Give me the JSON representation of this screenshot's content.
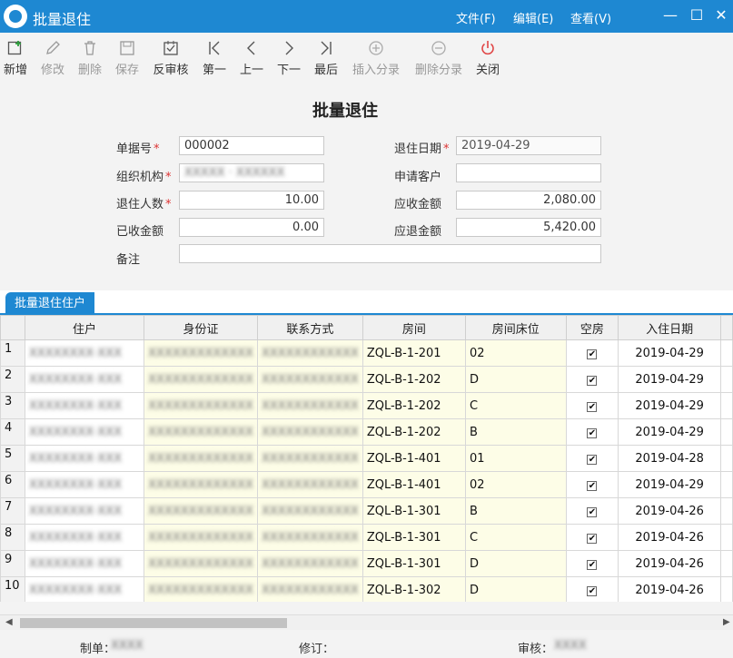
{
  "window": {
    "title": "批量退住",
    "menus": [
      "文件(F)",
      "编辑(E)",
      "查看(V)"
    ]
  },
  "toolbar": {
    "items": [
      {
        "label": "新增",
        "icon": "add-icon"
      },
      {
        "label": "修改",
        "icon": "edit-icon"
      },
      {
        "label": "删除",
        "icon": "trash-icon"
      },
      {
        "label": "保存",
        "icon": "save-icon"
      },
      {
        "label": "反审核",
        "icon": "unapprove-icon"
      },
      {
        "label": "第一",
        "icon": "first-icon"
      },
      {
        "label": "上一",
        "icon": "prev-icon"
      },
      {
        "label": "下一",
        "icon": "next-icon"
      },
      {
        "label": "最后",
        "icon": "last-icon"
      },
      {
        "label": "插入分录",
        "icon": "insert-row-icon"
      },
      {
        "label": "删除分录",
        "icon": "delete-row-icon"
      },
      {
        "label": "关闭",
        "icon": "power-icon"
      }
    ]
  },
  "form": {
    "title": "批量退住",
    "doc_no_label": "单据号",
    "doc_no": "000002",
    "checkout_date_label": "退住日期",
    "checkout_date": "2019-04-29",
    "org_label": "组织机构",
    "org": "XXXXX · XXXXXX",
    "customer_label": "申请客户",
    "customer": "",
    "count_label": "退住人数",
    "count": "10.00",
    "receivable_label": "应收金额",
    "receivable": "2,080.00",
    "received_label": "已收金额",
    "received": "0.00",
    "refund_label": "应退金额",
    "refund": "5,420.00",
    "remark_label": "备注",
    "remark": ""
  },
  "tab": {
    "label": "批量退住住户"
  },
  "grid": {
    "columns": [
      "住户",
      "身份证",
      "联系方式",
      "房间",
      "房间床位",
      "空房",
      "入住日期"
    ],
    "rows": [
      {
        "n": "1",
        "room": "ZQL-B-1-201",
        "bed": "02",
        "date": "2019-04-29"
      },
      {
        "n": "2",
        "room": "ZQL-B-1-202",
        "bed": "D",
        "date": "2019-04-29"
      },
      {
        "n": "3",
        "room": "ZQL-B-1-202",
        "bed": "C",
        "date": "2019-04-29"
      },
      {
        "n": "4",
        "room": "ZQL-B-1-202",
        "bed": "B",
        "date": "2019-04-29"
      },
      {
        "n": "5",
        "room": "ZQL-B-1-401",
        "bed": "01",
        "date": "2019-04-28"
      },
      {
        "n": "6",
        "room": "ZQL-B-1-401",
        "bed": "02",
        "date": "2019-04-29"
      },
      {
        "n": "7",
        "room": "ZQL-B-1-301",
        "bed": "B",
        "date": "2019-04-26"
      },
      {
        "n": "8",
        "room": "ZQL-B-1-301",
        "bed": "C",
        "date": "2019-04-26"
      },
      {
        "n": "9",
        "room": "ZQL-B-1-301",
        "bed": "D",
        "date": "2019-04-26"
      },
      {
        "n": "10",
        "room": "ZQL-B-1-302",
        "bed": "D",
        "date": "2019-04-26"
      }
    ]
  },
  "footer": {
    "maker_label": "制单：",
    "reviser_label": "修订：",
    "auditor_label": "审核："
  }
}
